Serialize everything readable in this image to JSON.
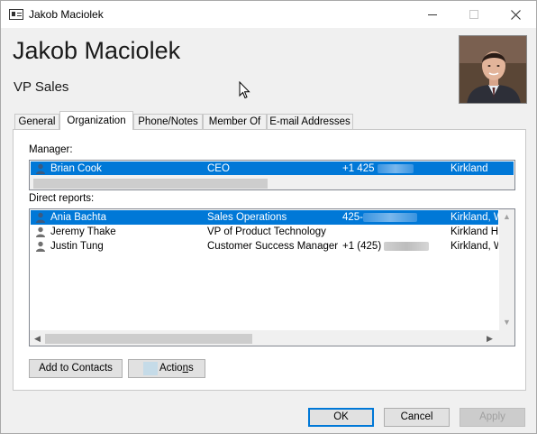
{
  "window": {
    "title": "Jakob Maciolek",
    "controls": {
      "minimize": "minimize-icon",
      "maximize": "maximize-icon",
      "close": "close-icon"
    }
  },
  "contact": {
    "name": "Jakob Maciolek",
    "job_title": "VP Sales"
  },
  "tabs": [
    {
      "label": "General"
    },
    {
      "label": "Organization",
      "active": true
    },
    {
      "label": "Phone/Notes"
    },
    {
      "label": "Member Of"
    },
    {
      "label": "E-mail Addresses"
    }
  ],
  "organization": {
    "manager_label": "Manager:",
    "manager": [
      {
        "name": "Brian Cook",
        "title": "CEO",
        "phone": "+1 425",
        "location": "Kirkland",
        "selected": true
      }
    ],
    "direct_reports_label": "Direct reports:",
    "direct_reports": [
      {
        "name": "Ania Bachta",
        "title": "Sales Operations",
        "phone": "425-",
        "location": "Kirkland, W",
        "selected": true
      },
      {
        "name": "Jeremy Thake",
        "title": "VP of Product Technology",
        "phone": "",
        "location": "Kirkland H",
        "selected": false
      },
      {
        "name": "Justin Tung",
        "title": "Customer Success Manager",
        "phone": "+1 (425)",
        "location": "Kirkland, W",
        "selected": false
      }
    ],
    "add_to_contacts_label": "Add to Contacts",
    "actions_label_pre": "Actio",
    "actions_label_underlined": "n",
    "actions_label_post": "s"
  },
  "footer": {
    "ok_label": "OK",
    "cancel_label": "Cancel",
    "apply_label": "Apply"
  },
  "colors": {
    "selection": "#0078d7",
    "window_bg": "#f0f0f0"
  }
}
